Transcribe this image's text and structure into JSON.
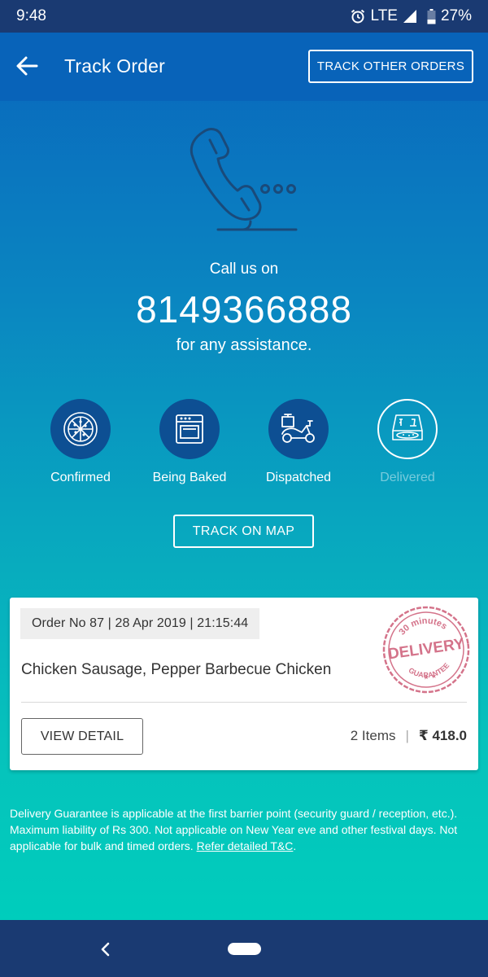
{
  "status_bar": {
    "time": "9:48",
    "network": "LTE",
    "battery": "27%",
    "icons": [
      "alarm-icon",
      "signal-icon",
      "battery-icon"
    ]
  },
  "app_bar": {
    "title": "Track Order",
    "back_icon": "arrow-left-icon",
    "track_other_label": "TRACK OTHER ORDERS"
  },
  "contact": {
    "icon": "phone-icon",
    "call_label": "Call us on",
    "phone_number": "8149366888",
    "assistance_label": "for any assistance."
  },
  "progress": {
    "steps": [
      {
        "label": "Confirmed",
        "icon": "pizza-icon",
        "state": "done"
      },
      {
        "label": "Being Baked",
        "icon": "oven-icon",
        "state": "done"
      },
      {
        "label": "Dispatched",
        "icon": "scooter-icon",
        "state": "done"
      },
      {
        "label": "Delivered",
        "icon": "pizza-box-icon",
        "state": "pending"
      }
    ]
  },
  "track_map_label": "TRACK ON MAP",
  "order": {
    "meta": "Order No 87 | 28 Apr 2019 | 21:15:44",
    "items": "Chicken Sausage, Pepper Barbecue Chicken",
    "view_detail_label": "VIEW DETAIL",
    "item_count": "2 Items",
    "separator": "|",
    "price": "₹ 418.0",
    "stamp": {
      "top": "30 minutes",
      "middle": "DELIVERY",
      "bottom": "GUARANTEE",
      "color": "#d4738a"
    }
  },
  "disclaimer": {
    "text": "Delivery Guarantee is applicable at the first barrier point (security guard / reception, etc.). Maximum liability of Rs 300. Not applicable on New Year eve and other festival days. Not applicable for bulk and timed orders. ",
    "link": "Refer detailed T&C",
    "suffix": "."
  },
  "nav_bar": {
    "icons": [
      "back-icon",
      "home-pill-icon"
    ]
  },
  "colors": {
    "status_bar": "#1a3a72",
    "app_bar": "#0863b9",
    "gradient_top": "#0966bd",
    "gradient_bottom": "#00cdbc",
    "step_circle": "#0d4f93"
  }
}
